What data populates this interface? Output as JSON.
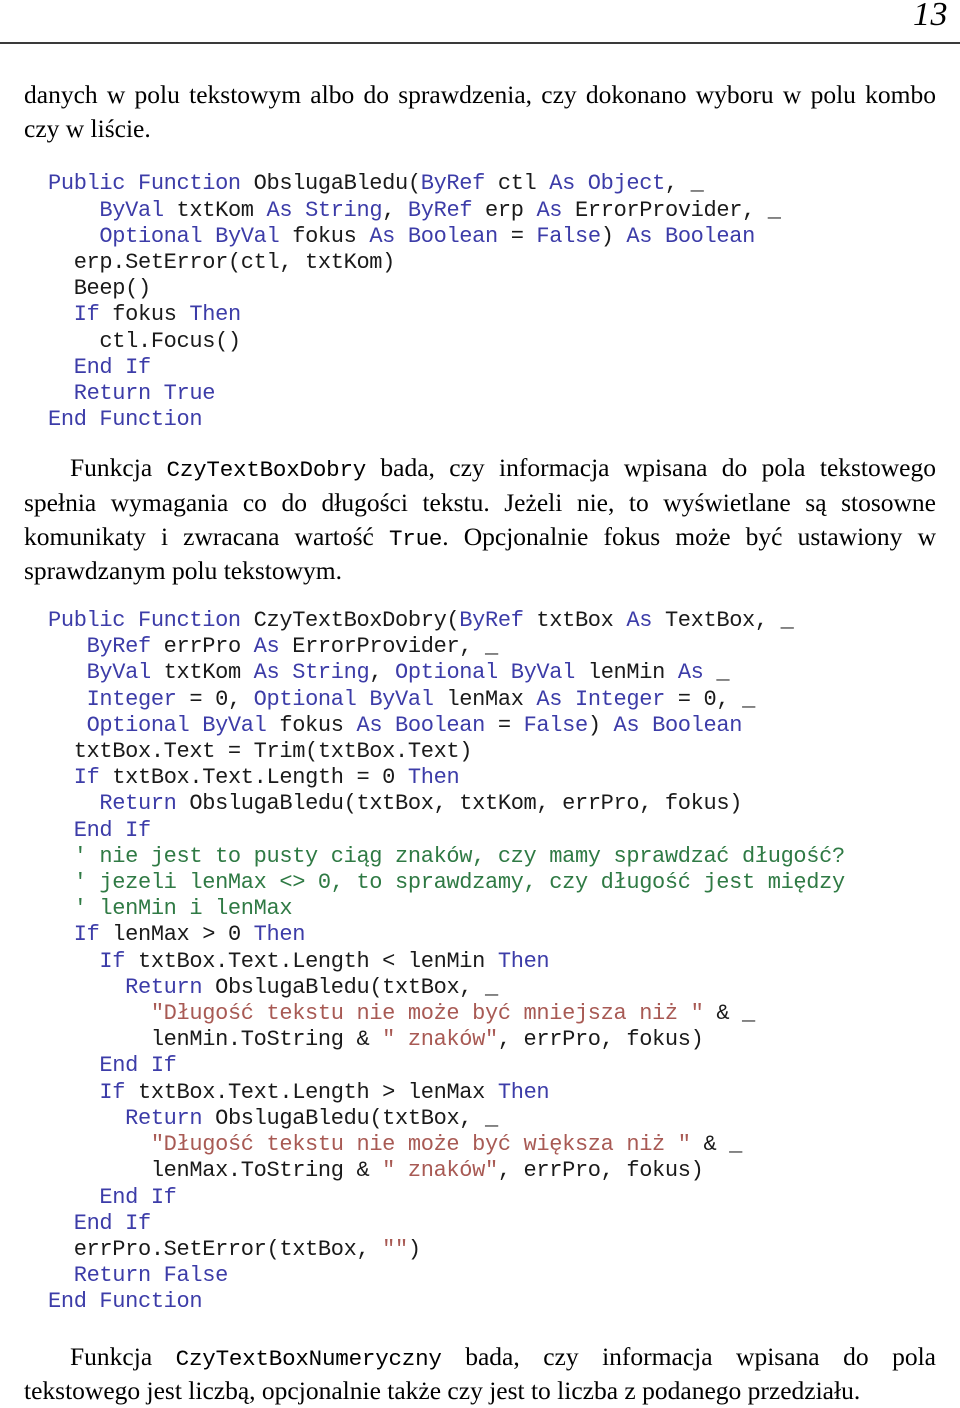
{
  "header": {
    "page_number": "13"
  },
  "paragraphs": {
    "intro": "danych w polu tekstowym albo do sprawdzenia, czy dokonano wyboru w polu kombo czy w liście.",
    "mid_part1": "Funkcja ",
    "mid_code1": "CzyTextBoxDobry",
    "mid_part2": " bada, czy informacja wpisana do pola tekstowego spełnia wymagania co do długości tekstu. Jeżeli nie, to wyświetlane są stosowne komunikaty i zwracana  wartość ",
    "mid_code2": "True",
    "mid_part3": ". Opcjonalnie fokus może być ustawiony w sprawdzanym polu tekstowym.",
    "end_part1": "Funkcja ",
    "end_code1": "CzyTextBoxNumeryczny",
    "end_part2": " bada, czy informacja wpisana do pola tekstowego jest liczbą, opcjonalnie także czy jest to liczba z podanego przedziału."
  },
  "code_block_1": {
    "name": "ObslugaBledu",
    "lines": [
      [
        {
          "t": "Public Function ",
          "c": "kw"
        },
        {
          "t": "ObslugaBledu(",
          "c": "id"
        },
        {
          "t": "ByRef",
          "c": "kw"
        },
        {
          "t": " ctl ",
          "c": "id"
        },
        {
          "t": "As Object",
          "c": "kw"
        },
        {
          "t": ", _",
          "c": "id"
        }
      ],
      [
        {
          "t": "    ",
          "c": "id"
        },
        {
          "t": "ByVal",
          "c": "kw"
        },
        {
          "t": " txtKom ",
          "c": "id"
        },
        {
          "t": "As String",
          "c": "kw"
        },
        {
          "t": ", ",
          "c": "id"
        },
        {
          "t": "ByRef",
          "c": "kw"
        },
        {
          "t": " erp ",
          "c": "id"
        },
        {
          "t": "As",
          "c": "kw"
        },
        {
          "t": " ErrorProvider, _",
          "c": "id"
        }
      ],
      [
        {
          "t": "    ",
          "c": "id"
        },
        {
          "t": "Optional ByVal",
          "c": "kw"
        },
        {
          "t": " fokus ",
          "c": "id"
        },
        {
          "t": "As Boolean",
          "c": "kw"
        },
        {
          "t": " = ",
          "c": "id"
        },
        {
          "t": "False",
          "c": "kw"
        },
        {
          "t": ") ",
          "c": "id"
        },
        {
          "t": "As Boolean",
          "c": "kw"
        }
      ],
      [
        {
          "t": "  erp.SetError(ctl, txtKom)",
          "c": "id"
        }
      ],
      [
        {
          "t": "  Beep()",
          "c": "id"
        }
      ],
      [
        {
          "t": "  ",
          "c": "id"
        },
        {
          "t": "If",
          "c": "kw"
        },
        {
          "t": " fokus ",
          "c": "id"
        },
        {
          "t": "Then",
          "c": "kw"
        }
      ],
      [
        {
          "t": "    ctl.Focus()",
          "c": "id"
        }
      ],
      [
        {
          "t": "  ",
          "c": "id"
        },
        {
          "t": "End If",
          "c": "kw"
        }
      ],
      [
        {
          "t": "  ",
          "c": "id"
        },
        {
          "t": "Return True",
          "c": "kw"
        }
      ],
      [
        {
          "t": "End Function",
          "c": "kw"
        }
      ]
    ]
  },
  "code_block_2": {
    "name": "CzyTextBoxDobry",
    "lines": [
      [
        {
          "t": "Public Function ",
          "c": "kw"
        },
        {
          "t": "CzyTextBoxDobry(",
          "c": "id"
        },
        {
          "t": "ByRef",
          "c": "kw"
        },
        {
          "t": " txtBox ",
          "c": "id"
        },
        {
          "t": "As",
          "c": "kw"
        },
        {
          "t": " TextBox, _",
          "c": "id"
        }
      ],
      [
        {
          "t": "   ",
          "c": "id"
        },
        {
          "t": "ByRef",
          "c": "kw"
        },
        {
          "t": " errPro ",
          "c": "id"
        },
        {
          "t": "As",
          "c": "kw"
        },
        {
          "t": " ErrorProvider, _",
          "c": "id"
        }
      ],
      [
        {
          "t": "   ",
          "c": "id"
        },
        {
          "t": "ByVal",
          "c": "kw"
        },
        {
          "t": " txtKom ",
          "c": "id"
        },
        {
          "t": "As String",
          "c": "kw"
        },
        {
          "t": ", ",
          "c": "id"
        },
        {
          "t": "Optional ByVal",
          "c": "kw"
        },
        {
          "t": " lenMin ",
          "c": "id"
        },
        {
          "t": "As",
          "c": "kw"
        },
        {
          "t": " _",
          "c": "id"
        }
      ],
      [
        {
          "t": "   ",
          "c": "id"
        },
        {
          "t": "Integer",
          "c": "kw"
        },
        {
          "t": " = 0, ",
          "c": "id"
        },
        {
          "t": "Optional ByVal",
          "c": "kw"
        },
        {
          "t": " lenMax ",
          "c": "id"
        },
        {
          "t": "As Integer",
          "c": "kw"
        },
        {
          "t": " = 0, _",
          "c": "id"
        }
      ],
      [
        {
          "t": "   ",
          "c": "id"
        },
        {
          "t": "Optional ByVal",
          "c": "kw"
        },
        {
          "t": " fokus ",
          "c": "id"
        },
        {
          "t": "As Boolean",
          "c": "kw"
        },
        {
          "t": " = ",
          "c": "id"
        },
        {
          "t": "False",
          "c": "kw"
        },
        {
          "t": ") ",
          "c": "id"
        },
        {
          "t": "As Boolean",
          "c": "kw"
        }
      ],
      [
        {
          "t": "  txtBox.Text = Trim(txtBox.Text)",
          "c": "id"
        }
      ],
      [
        {
          "t": "  ",
          "c": "id"
        },
        {
          "t": "If",
          "c": "kw"
        },
        {
          "t": " txtBox.Text.Length = 0 ",
          "c": "id"
        },
        {
          "t": "Then",
          "c": "kw"
        }
      ],
      [
        {
          "t": "    ",
          "c": "id"
        },
        {
          "t": "Return",
          "c": "kw"
        },
        {
          "t": " ObslugaBledu(txtBox, txtKom, errPro, fokus)",
          "c": "id"
        }
      ],
      [
        {
          "t": "  ",
          "c": "id"
        },
        {
          "t": "End If",
          "c": "kw"
        }
      ],
      [
        {
          "t": "  ' nie jest to pusty ciąg znaków, czy mamy sprawdzać długość?",
          "c": "cmt"
        }
      ],
      [
        {
          "t": "  ' jezeli lenMax <> 0, to sprawdzamy, czy długość jest między",
          "c": "cmt"
        }
      ],
      [
        {
          "t": "  ' lenMin i lenMax",
          "c": "cmt"
        }
      ],
      [
        {
          "t": "  ",
          "c": "id"
        },
        {
          "t": "If",
          "c": "kw"
        },
        {
          "t": " lenMax > 0 ",
          "c": "id"
        },
        {
          "t": "Then",
          "c": "kw"
        }
      ],
      [
        {
          "t": "    ",
          "c": "id"
        },
        {
          "t": "If",
          "c": "kw"
        },
        {
          "t": " txtBox.Text.Length < lenMin ",
          "c": "id"
        },
        {
          "t": "Then",
          "c": "kw"
        }
      ],
      [
        {
          "t": "      ",
          "c": "id"
        },
        {
          "t": "Return",
          "c": "kw"
        },
        {
          "t": " ObslugaBledu(txtBox, _",
          "c": "id"
        }
      ],
      [
        {
          "t": "        ",
          "c": "id"
        },
        {
          "t": "\"Długość tekstu nie może być mniejsza niż \"",
          "c": "str"
        },
        {
          "t": " & _",
          "c": "id"
        }
      ],
      [
        {
          "t": "        lenMin.ToString & ",
          "c": "id"
        },
        {
          "t": "\" znaków\"",
          "c": "str"
        },
        {
          "t": ", errPro, fokus)",
          "c": "id"
        }
      ],
      [
        {
          "t": "    ",
          "c": "id"
        },
        {
          "t": "End If",
          "c": "kw"
        }
      ],
      [
        {
          "t": "    ",
          "c": "id"
        },
        {
          "t": "If",
          "c": "kw"
        },
        {
          "t": " txtBox.Text.Length > lenMax ",
          "c": "id"
        },
        {
          "t": "Then",
          "c": "kw"
        }
      ],
      [
        {
          "t": "      ",
          "c": "id"
        },
        {
          "t": "Return",
          "c": "kw"
        },
        {
          "t": " ObslugaBledu(txtBox, _",
          "c": "id"
        }
      ],
      [
        {
          "t": "        ",
          "c": "id"
        },
        {
          "t": "\"Długość tekstu nie może być większa niż \"",
          "c": "str"
        },
        {
          "t": " & _",
          "c": "id"
        }
      ],
      [
        {
          "t": "        lenMax.ToString & ",
          "c": "id"
        },
        {
          "t": "\" znaków\"",
          "c": "str"
        },
        {
          "t": ", errPro, fokus)",
          "c": "id"
        }
      ],
      [
        {
          "t": "    ",
          "c": "id"
        },
        {
          "t": "End If",
          "c": "kw"
        }
      ],
      [
        {
          "t": "  ",
          "c": "id"
        },
        {
          "t": "End If",
          "c": "kw"
        }
      ],
      [
        {
          "t": "  errPro.SetError(txtBox, ",
          "c": "id"
        },
        {
          "t": "\"\"",
          "c": "str"
        },
        {
          "t": ")",
          "c": "id"
        }
      ],
      [
        {
          "t": "  ",
          "c": "id"
        },
        {
          "t": "Return False",
          "c": "kw"
        }
      ],
      [
        {
          "t": "End Function",
          "c": "kw"
        }
      ]
    ]
  }
}
